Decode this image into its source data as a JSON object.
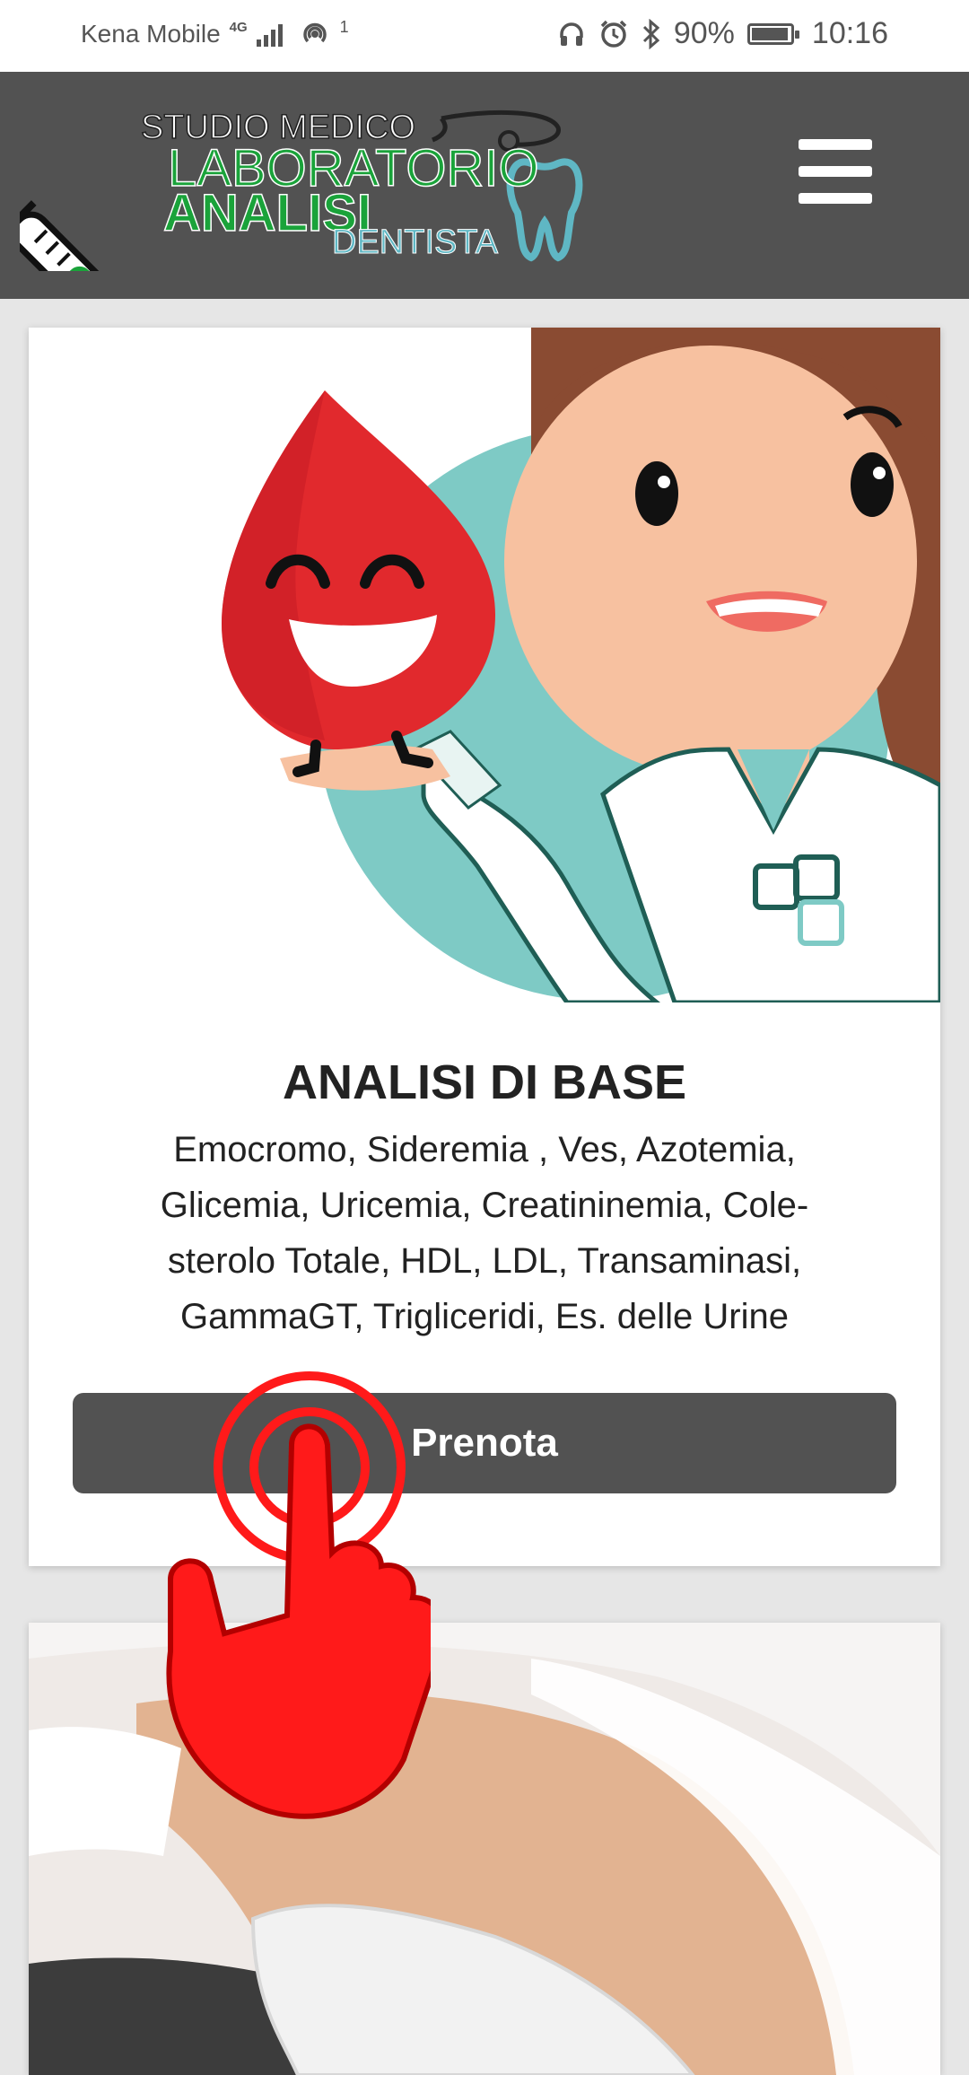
{
  "status_bar": {
    "carrier": "Kena Mobile",
    "network": "4G",
    "hotspot_count": "1",
    "battery": "90%",
    "battery_level": 0.9,
    "time": "10:16"
  },
  "header": {
    "logo_text": {
      "line1": "STUDIO MEDICO",
      "line2": "LABORATORIO",
      "line3": "ANALISI",
      "line4": "DENTISTA"
    }
  },
  "card": {
    "title": "ANALISI DI BASE",
    "description_lines": [
      "Emocromo, Sideremia , Ves, Azotemia,",
      "Glicemia, Uricemia, Creatininemia, Cole-",
      "sterolo Totale, HDL, LDL, Transaminasi,",
      "GammaGT, Trigliceridi, Es. delle Urine"
    ],
    "button_label": "Prenota"
  },
  "colors": {
    "header_bg": "#525252",
    "button_bg": "#525252",
    "logo_green": "#1aa33a",
    "logo_teal": "#5fb7c4",
    "tap_red": "#ff1a1a"
  }
}
